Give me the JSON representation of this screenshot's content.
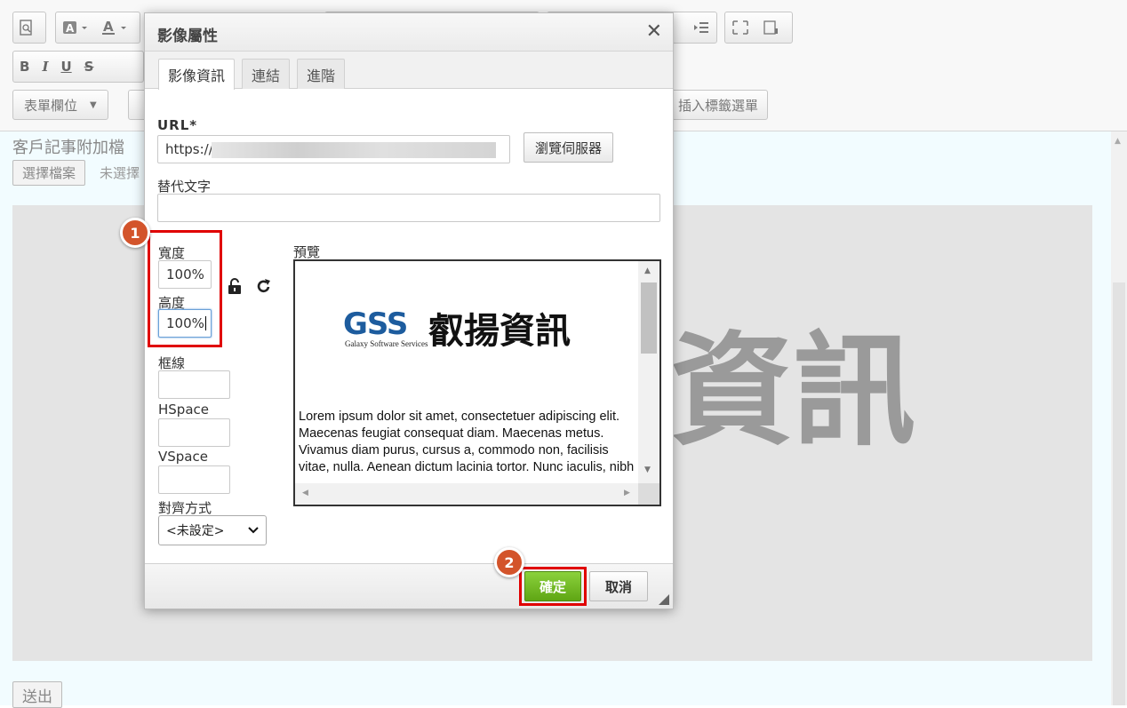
{
  "toolbar": {
    "row1_icons": [
      "preview-icon",
      "text-color-icon",
      "bg-color-icon",
      "outdent-icon",
      "maximize-icon",
      "show-blocks-icon"
    ],
    "row2": {
      "bold": "B",
      "italic": "I",
      "underline": "U",
      "strike": "S"
    },
    "form_field_label": "表單欄位",
    "insert_tag_label": "插入標籤選單"
  },
  "page": {
    "attach_label": "客戶記事附加檔",
    "choose_file": "選擇檔案",
    "no_file": "未選擇",
    "image_bg_text": "資訊",
    "submit": "送出"
  },
  "dialog": {
    "title": "影像屬性",
    "tabs": [
      {
        "label": "影像資訊",
        "active": true
      },
      {
        "label": "連結",
        "active": false
      },
      {
        "label": "進階",
        "active": false
      }
    ],
    "url_label": "URL*",
    "url_value": "https://",
    "browse_button": "瀏覽伺服器",
    "alt_label": "替代文字",
    "alt_value": "",
    "width_label": "寬度",
    "width_value": "100%",
    "height_label": "高度",
    "height_value": "100%",
    "border_label": "框線",
    "border_value": "",
    "hspace_label": "HSpace",
    "hspace_value": "",
    "vspace_label": "VSpace",
    "vspace_value": "",
    "align_label": "對齊方式",
    "align_value": "<未設定>",
    "preview_label": "預覽",
    "preview_logo_mark": "GSS",
    "preview_logo_sub": "Galaxy Software Services",
    "preview_logo_cn": "叡揚資訊",
    "preview_text": "Lorem ipsum dolor sit amet, consectetuer adipiscing elit. Maecenas feugiat consequat diam. Maecenas metus. Vivamus diam purus, cursus a, commodo non, facilisis vitae, nulla. Aenean dictum lacinia tortor. Nunc iaculis, nibh",
    "ok_button": "確定",
    "cancel_button": "取消"
  },
  "annotations": {
    "step1": "1",
    "step2": "2",
    "highlight_color": "#e00000",
    "badge_color": "#d3542b"
  },
  "colors": {
    "ok_green": "#6fbf1f",
    "editor_bg": "#f2fcff"
  }
}
